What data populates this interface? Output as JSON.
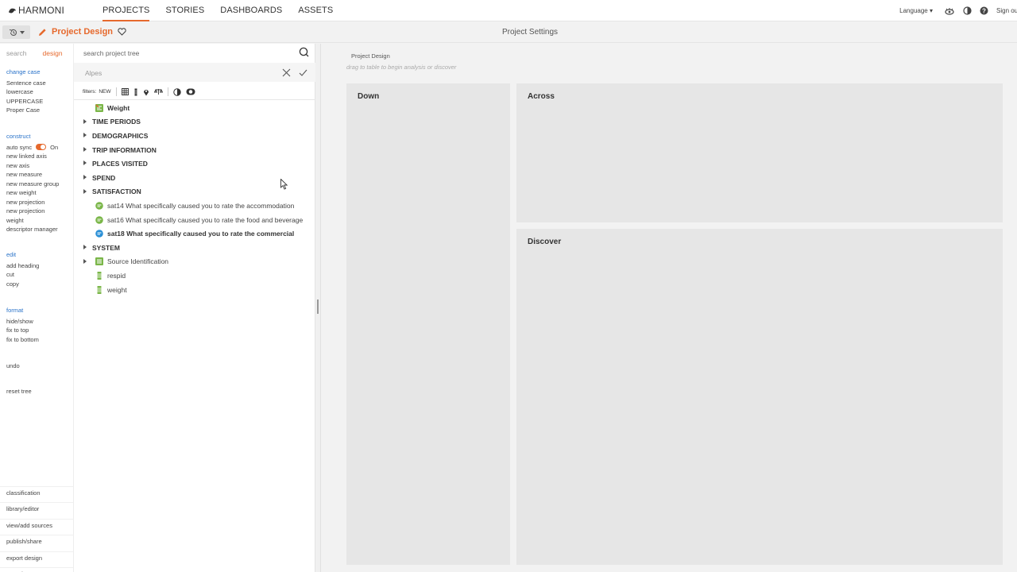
{
  "app": {
    "logo": "HARMONI",
    "nav_tabs": [
      {
        "label": "PROJECTS",
        "active": true
      },
      {
        "label": "STORIES",
        "active": false
      },
      {
        "label": "DASHBOARDS",
        "active": false
      },
      {
        "label": "ASSETS",
        "active": false
      }
    ],
    "language_label": "Language",
    "signout_label": "Sign out"
  },
  "subbar": {
    "project_title": "Project Design",
    "settings_label": "Project Settings"
  },
  "commands": {
    "mode_tabs": [
      {
        "label": "search",
        "active": false
      },
      {
        "label": "design",
        "active": true
      }
    ],
    "change_case": {
      "header": "change case",
      "items": [
        "Sentence case",
        "lowercase",
        "UPPERCASE",
        "Proper Case"
      ]
    },
    "construct": {
      "header": "construct",
      "auto_sync_label": "auto sync",
      "auto_sync_state": "On",
      "items": [
        "new linked axis",
        "new axis",
        "new measure",
        "new measure group",
        "new weight",
        "new projection",
        "new projection",
        "weight",
        "descriptor manager"
      ]
    },
    "edit": {
      "header": "edit",
      "items": [
        "add heading",
        "cut",
        "copy"
      ]
    },
    "format": {
      "header": "format",
      "items": [
        "hide/show",
        "fix to top",
        "fix to bottom"
      ]
    },
    "undo_label": "undo",
    "reset_label": "reset tree",
    "bottom_links": [
      "classification",
      "library/editor",
      "view/add sources",
      "publish/share",
      "export design",
      "metadata"
    ]
  },
  "tree": {
    "search_placeholder": "search project tree",
    "filter_value": "Alpes",
    "filters_label": "filters:",
    "filters_new": "NEW",
    "nodes": [
      {
        "type": "leaf",
        "icon": "weight",
        "label": "Weight",
        "bold": true
      },
      {
        "type": "folder",
        "label": "TIME PERIODS"
      },
      {
        "type": "folder",
        "label": "DEMOGRAPHICS"
      },
      {
        "type": "folder",
        "label": "TRIP INFORMATION"
      },
      {
        "type": "folder",
        "label": "PLACES VISITED"
      },
      {
        "type": "folder",
        "label": "SPEND"
      },
      {
        "type": "folder",
        "label": "SATISFACTION"
      },
      {
        "type": "leaf",
        "icon": "text-green",
        "label": "sat14 What specifically caused you to rate the accommodation"
      },
      {
        "type": "leaf",
        "icon": "text-green",
        "label": "sat16 What specifically caused you to rate the food and beverage"
      },
      {
        "type": "leaf",
        "icon": "text-blue",
        "label": "sat18 What specifically caused you to rate the commercial",
        "bold": true
      },
      {
        "type": "folder",
        "label": "SYSTEM"
      },
      {
        "type": "folder-leaf",
        "icon": "list",
        "label": "Source Identification"
      },
      {
        "type": "leaf",
        "icon": "numeric",
        "label": "respid"
      },
      {
        "type": "leaf",
        "icon": "numeric",
        "label": "weight"
      }
    ]
  },
  "work": {
    "breadcrumb": "Project Design",
    "hint": "drag to table to begin analysis or discover",
    "down_label": "Down",
    "across_label": "Across",
    "discover_label": "Discover"
  },
  "colors": {
    "accent": "#e6692d",
    "link": "#2a73c9",
    "green": "#7ab648",
    "blue": "#2a8fd6"
  }
}
